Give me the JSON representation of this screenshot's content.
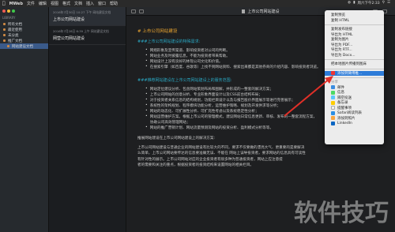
{
  "menubar": {
    "app": "MWeb",
    "items": [
      "文件",
      "编辑",
      "视图",
      "格式",
      "文档",
      "插入",
      "窗口",
      "帮助"
    ],
    "clock": "周六下午2:33"
  },
  "sidebar": {
    "header": "LIBRARY",
    "items": [
      {
        "label": "所有文档"
      },
      {
        "label": "最近使用"
      },
      {
        "label": "未分类"
      },
      {
        "label": "推广文档"
      },
      {
        "label": "网站建设文档"
      }
    ]
  },
  "doclist": {
    "docs": [
      {
        "meta": "2016年7月30日 10:27 下午  网站建设文档",
        "title": "上市公司网站建设"
      },
      {
        "meta": "2016年7月28日 6:39 上午  网站建设文档",
        "title": "网营公司网站建设"
      }
    ]
  },
  "editor": {
    "title": "上市公司网站建设",
    "h1": "# 上市公司网站建设",
    "h3a": "###上市公司网站建设的特殊需求:",
    "list_a": [
      "网络形象及宣传渠道、影响投资者对公司的判断。",
      "网站业务及时披露信息，不能为投资者带来帮助。",
      "网站设计上没有良好的体现公司文化和价值。",
      "在搜索引擎（如百度、谷歌等）上找不到网站资料、搜索出来都是其他券商的介绍内容、影响投资者浏览。"
    ],
    "h3b": "###推荐网站建设在上市公司网站建设上的服务范围:",
    "list_b": [
      "网站定位建议分析、包含网站策划布局和图解，并形成的一整套的解决方案；",
      "上市公司网站的创意分析、专业形象界面设计以及CSS前台结构布局；",
      "对于投资者关系信息的结构规划，功能栏目设计以及与报告股价界面展示等进行完善展示；",
      "系统性的架构规划、程序模块功能分析，运营维护策略、规划及开发供求等分析；",
      "网站的动态化、可扩展性分析、可扩充性考虑以及系统稳定性分析；",
      "网站运营维护方案。根据上市公司的管理模式，建议网站日常信息更新、审核、发布的一整套流程方案，",
      "协助公司高效管理网站；",
      "网站的推广营销计划、网站流量预测及网站的投资分析、盈利模式分析等等。"
    ],
    "para": [
      "推展网站建设在上市公司网站建设上的解决方案:",
      "上市公司网站建设与普通企业的网站建设有比较大的不同，要求不仅要做的漂亮大气、更重要的是要解决",
      "么简单，上市公司网站要传达的信息要准确无误、不能在 网站上误导投资者，要求网站的信息具有可读性",
      "有针对性的展示。上市公司网站对应的企业投资者有很多种为普通投资者，网站上应注意提",
      "者的需要和关注的重点，根据投资者的投资结构来设置网站的相关栏目。"
    ]
  },
  "menu": {
    "items": [
      "复制预览",
      "复制 HTML",
      "复制发布链接",
      "导出为 HTML",
      "复制为图片",
      "导出为 PDF...",
      "导出为 RTF...",
      "导出为 Docx..."
    ],
    "bottom_label": "把本地图片传播到图床",
    "highlight": "添加到微博推...",
    "services_header": "分享",
    "services": [
      "邮件",
      "信息",
      "隔空投送",
      "备忘录",
      "提醒事项",
      "Safari阅读列表",
      "添加到照片",
      "LinkedIn"
    ]
  },
  "watermark": {
    "text": "软件技巧"
  },
  "colors": {
    "accent_orange": "#f0a830",
    "accent_cyan": "#2aa7c2",
    "highlight_blue": "#2d7cd9",
    "arrow_red": "#e03028"
  }
}
